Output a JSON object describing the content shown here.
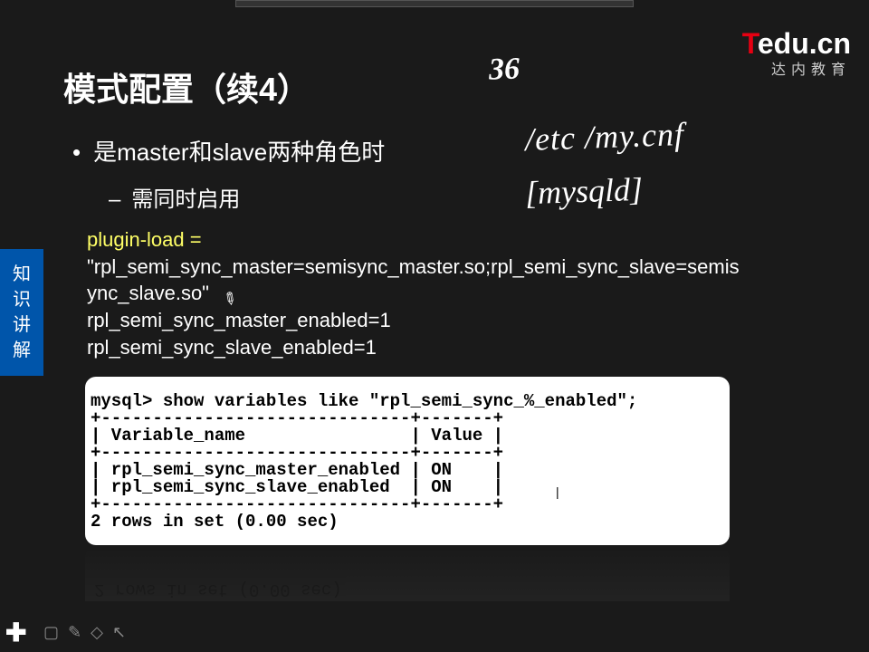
{
  "logo": {
    "brand_t": "T",
    "brand_rest": "edu.cn",
    "subtitle": "达内教育"
  },
  "title": "模式配置（续4）",
  "bullet_main": "是master和slave两种角色时",
  "bullet_sub": "需同时启用",
  "sidebar": {
    "l1": "知",
    "l2": "识",
    "l3": "讲",
    "l4": "解"
  },
  "config": {
    "line1": "plugin-load =",
    "line2a": "\"rpl_semi_sync_master=semisync_master.so;rpl_semi_sync_slave=semis",
    "line2b": "ync_slave.so\"",
    "line3": "rpl_semi_sync_master_enabled=1",
    "line4": "rpl_semi_sync_slave_enabled=1"
  },
  "terminal_text": "mysql> show variables like \"rpl_semi_sync_%_enabled\";\n+------------------------------+-------+\n| Variable_name                | Value |\n+------------------------------+-------+\n| rpl_semi_sync_master_enabled | ON    |\n| rpl_semi_sync_slave_enabled  | ON    |\n+------------------------------+-------+\n2 rows in set (0.00 sec)",
  "reflection_text": "2 rows in set (0.00 sec)",
  "handwriting": {
    "note1": "36",
    "note2": "/etc /my.cnf",
    "note3": "[mysqld]"
  },
  "icons": {
    "plus": "✚",
    "square": "▢",
    "edit": "✎",
    "eraser": "◇",
    "cursor": "↖"
  }
}
